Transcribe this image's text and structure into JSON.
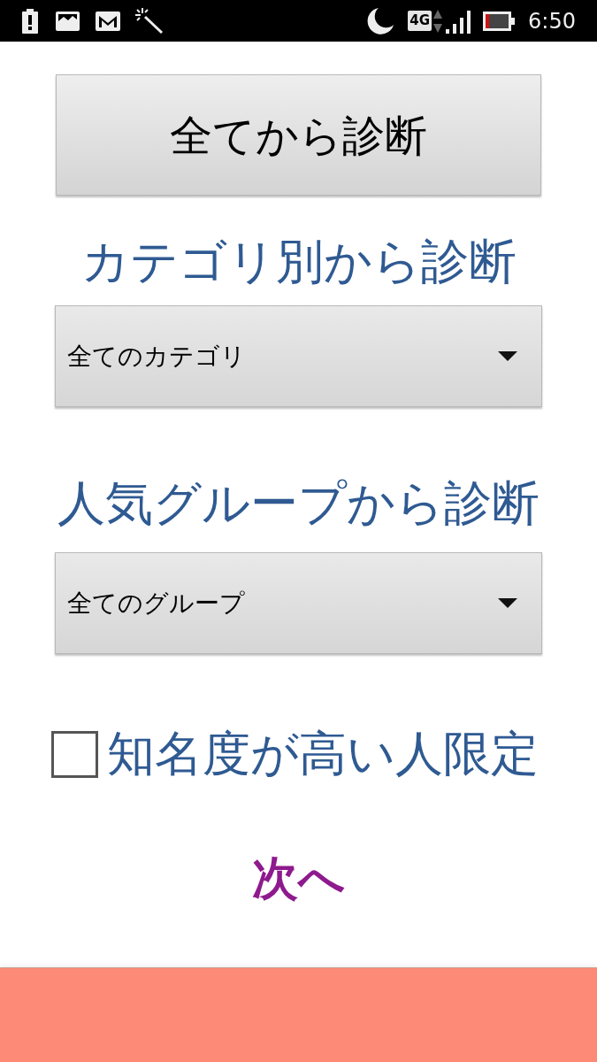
{
  "status_bar": {
    "network": "4G",
    "time": "6:50"
  },
  "diagnose_all_button": {
    "label": "全てから診断"
  },
  "category_section": {
    "heading": "カテゴリ別から診断",
    "dropdown": {
      "value": "全てのカテゴリ"
    }
  },
  "group_section": {
    "heading": "人気グループから診断",
    "dropdown": {
      "value": "全てのグループ"
    }
  },
  "famous_only": {
    "label": "知名度が高い人限定",
    "checked": false
  },
  "next_link": {
    "label": "次へ"
  }
}
